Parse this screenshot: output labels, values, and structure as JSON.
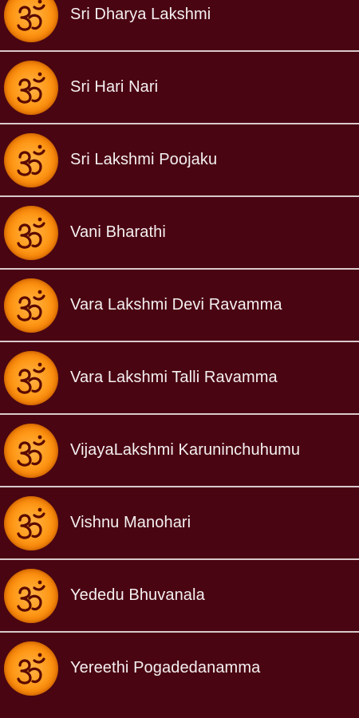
{
  "songs": [
    {
      "title": "Sri Dharya Lakshmi",
      "icon": "om-icon"
    },
    {
      "title": "Sri Hari Nari",
      "icon": "om-icon"
    },
    {
      "title": "Sri Lakshmi Poojaku",
      "icon": "om-icon"
    },
    {
      "title": "Vani Bharathi",
      "icon": "om-icon"
    },
    {
      "title": "Vara Lakshmi Devi Ravamma",
      "icon": "om-icon"
    },
    {
      "title": "Vara Lakshmi Talli Ravamma",
      "icon": "om-icon"
    },
    {
      "title": "VijayaLakshmi Karuninchuhumu",
      "icon": "om-icon"
    },
    {
      "title": "Vishnu Manohari",
      "icon": "om-icon"
    },
    {
      "title": "Yededu Bhuvanala",
      "icon": "om-icon"
    },
    {
      "title": "Yereethi Pogadedanamma",
      "icon": "om-icon"
    }
  ],
  "colors": {
    "background": "#4a0512",
    "divider": "#d9c9cc",
    "text": "#f4f0f1",
    "icon_orange": "#ff9a1a",
    "om_glyph": "#5a0a00"
  }
}
